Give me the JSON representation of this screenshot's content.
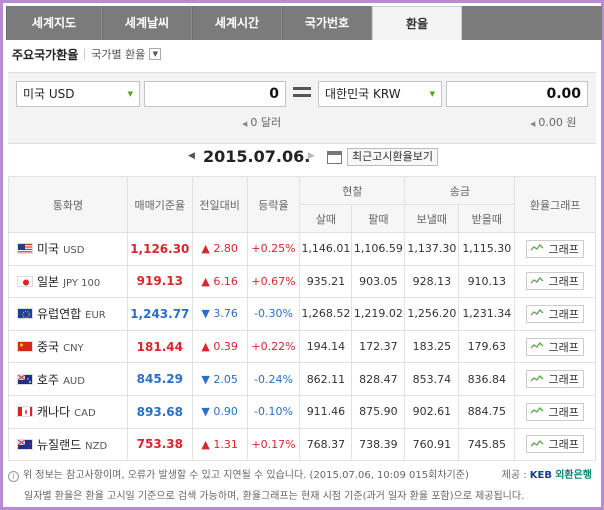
{
  "tabs": [
    "세계지도",
    "세계날씨",
    "세계시간",
    "국가번호",
    "환율"
  ],
  "sub": {
    "title": "주요국가환율",
    "select": "국가별 환율"
  },
  "converter": {
    "from_currency": "미국 USD",
    "from_amount": "0",
    "from_hint": "0 달러",
    "to_currency": "대한민국 KRW",
    "to_amount": "0.00",
    "to_hint": "0.00 원"
  },
  "date": "2015.07.06.",
  "recent_button": "최근고시환율보기",
  "table": {
    "headers": {
      "currency": "통화명",
      "base": "매매기준율",
      "change": "전일대비",
      "pct": "등락율",
      "cash": "현찰",
      "remit": "송금",
      "graph": "환율그래프",
      "buy": "살때",
      "sell": "팔때",
      "send": "보낼때",
      "receive": "받을때"
    },
    "rows": [
      {
        "name": "미국",
        "code": "USD",
        "rate": "1,126.30",
        "dir": "up",
        "change": "▲ 2.80",
        "pct": "+0.25%",
        "cash_buy": "1,146.01",
        "cash_sell": "1,106.59",
        "send": "1,137.30",
        "receive": "1,115.30",
        "flag": "us"
      },
      {
        "name": "일본",
        "code": "JPY 100",
        "rate": "919.13",
        "dir": "up",
        "change": "▲ 6.16",
        "pct": "+0.67%",
        "cash_buy": "935.21",
        "cash_sell": "903.05",
        "send": "928.13",
        "receive": "910.13",
        "flag": "jp"
      },
      {
        "name": "유럽연합",
        "code": "EUR",
        "rate": "1,243.77",
        "dir": "down",
        "change": "▼ 3.76",
        "pct": "-0.30%",
        "cash_buy": "1,268.52",
        "cash_sell": "1,219.02",
        "send": "1,256.20",
        "receive": "1,231.34",
        "flag": "eu"
      },
      {
        "name": "중국",
        "code": "CNY",
        "rate": "181.44",
        "dir": "up",
        "change": "▲ 0.39",
        "pct": "+0.22%",
        "cash_buy": "194.14",
        "cash_sell": "172.37",
        "send": "183.25",
        "receive": "179.63",
        "flag": "cn"
      },
      {
        "name": "호주",
        "code": "AUD",
        "rate": "845.29",
        "dir": "down",
        "change": "▼ 2.05",
        "pct": "-0.24%",
        "cash_buy": "862.11",
        "cash_sell": "828.47",
        "send": "853.74",
        "receive": "836.84",
        "flag": "au"
      },
      {
        "name": "캐나다",
        "code": "CAD",
        "rate": "893.68",
        "dir": "down",
        "change": "▼ 0.90",
        "pct": "-0.10%",
        "cash_buy": "911.46",
        "cash_sell": "875.90",
        "send": "902.61",
        "receive": "884.75",
        "flag": "ca"
      },
      {
        "name": "뉴질랜드",
        "code": "NZD",
        "rate": "753.38",
        "dir": "up",
        "change": "▲ 1.31",
        "pct": "+0.17%",
        "cash_buy": "768.37",
        "cash_sell": "738.39",
        "send": "760.91",
        "receive": "745.85",
        "flag": "nz"
      }
    ],
    "graph_label": "그래프"
  },
  "notes": {
    "line1": "위 정보는 참고사항이며, 오류가 발생할 수 있고 지연될 수 있습니다. (2015.07.06, 10:09 015회차기준)",
    "provider_label": "제공 :",
    "provider_keb": "KEB",
    "provider_hana": "외환은행",
    "line2": "일자별 환율은 환율 고시일 기준으로 검색 가능하며, 환율그래프는 현재 시점 기준(과거 일자 환율 포함)으로 제공됩니다."
  },
  "colors": {
    "up": "#d8262c",
    "down": "#2a6fc7",
    "frame": "#b98ad6",
    "tabbar": "#7b7b7b"
  }
}
